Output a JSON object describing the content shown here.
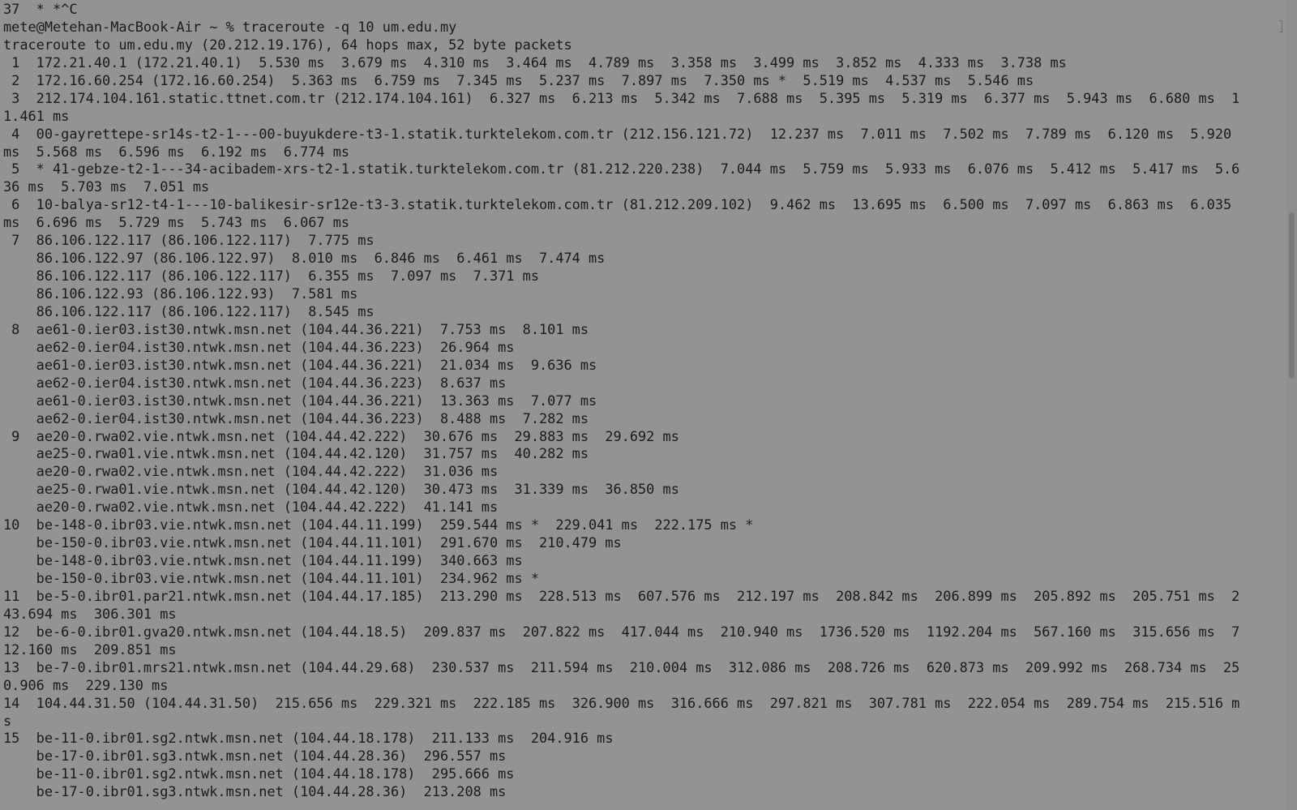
{
  "terminal": {
    "lines": [
      "37  * *^C",
      "mete@Metehan-MacBook-Air ~ % traceroute -q 10 um.edu.my",
      "traceroute to um.edu.my (20.212.19.176), 64 hops max, 52 byte packets",
      " 1  172.21.40.1 (172.21.40.1)  5.530 ms  3.679 ms  4.310 ms  3.464 ms  4.789 ms  3.358 ms  3.499 ms  3.852 ms  4.333 ms  3.738 ms",
      " 2  172.16.60.254 (172.16.60.254)  5.363 ms  6.759 ms  7.345 ms  5.237 ms  7.897 ms  7.350 ms *  5.519 ms  4.537 ms  5.546 ms",
      " 3  212.174.104.161.static.ttnet.com.tr (212.174.104.161)  6.327 ms  6.213 ms  5.342 ms  7.688 ms  5.395 ms  5.319 ms  6.377 ms  5.943 ms  6.680 ms  1",
      "1.461 ms",
      " 4  00-gayrettepe-sr14s-t2-1---00-buyukdere-t3-1.statik.turktelekom.com.tr (212.156.121.72)  12.237 ms  7.011 ms  7.502 ms  7.789 ms  6.120 ms  5.920",
      "ms  5.568 ms  6.596 ms  6.192 ms  6.774 ms",
      " 5  * 41-gebze-t2-1---34-acibadem-xrs-t2-1.statik.turktelekom.com.tr (81.212.220.238)  7.044 ms  5.759 ms  5.933 ms  6.076 ms  5.412 ms  5.417 ms  5.6",
      "36 ms  5.703 ms  7.051 ms",
      " 6  10-balya-sr12-t4-1---10-balikesir-sr12e-t3-3.statik.turktelekom.com.tr (81.212.209.102)  9.462 ms  13.695 ms  6.500 ms  7.097 ms  6.863 ms  6.035",
      "ms  6.696 ms  5.729 ms  5.743 ms  6.067 ms",
      " 7  86.106.122.117 (86.106.122.117)  7.775 ms",
      "    86.106.122.97 (86.106.122.97)  8.010 ms  6.846 ms  6.461 ms  7.474 ms",
      "    86.106.122.117 (86.106.122.117)  6.355 ms  7.097 ms  7.371 ms",
      "    86.106.122.93 (86.106.122.93)  7.581 ms",
      "    86.106.122.117 (86.106.122.117)  8.545 ms",
      " 8  ae61-0.ier03.ist30.ntwk.msn.net (104.44.36.221)  7.753 ms  8.101 ms",
      "    ae62-0.ier04.ist30.ntwk.msn.net (104.44.36.223)  26.964 ms",
      "    ae61-0.ier03.ist30.ntwk.msn.net (104.44.36.221)  21.034 ms  9.636 ms",
      "    ae62-0.ier04.ist30.ntwk.msn.net (104.44.36.223)  8.637 ms",
      "    ae61-0.ier03.ist30.ntwk.msn.net (104.44.36.221)  13.363 ms  7.077 ms",
      "    ae62-0.ier04.ist30.ntwk.msn.net (104.44.36.223)  8.488 ms  7.282 ms",
      " 9  ae20-0.rwa02.vie.ntwk.msn.net (104.44.42.222)  30.676 ms  29.883 ms  29.692 ms",
      "    ae25-0.rwa01.vie.ntwk.msn.net (104.44.42.120)  31.757 ms  40.282 ms",
      "    ae20-0.rwa02.vie.ntwk.msn.net (104.44.42.222)  31.036 ms",
      "    ae25-0.rwa01.vie.ntwk.msn.net (104.44.42.120)  30.473 ms  31.339 ms  36.850 ms",
      "    ae20-0.rwa02.vie.ntwk.msn.net (104.44.42.222)  41.141 ms",
      "10  be-148-0.ibr03.vie.ntwk.msn.net (104.44.11.199)  259.544 ms *  229.041 ms  222.175 ms *",
      "    be-150-0.ibr03.vie.ntwk.msn.net (104.44.11.101)  291.670 ms  210.479 ms",
      "    be-148-0.ibr03.vie.ntwk.msn.net (104.44.11.199)  340.663 ms",
      "    be-150-0.ibr03.vie.ntwk.msn.net (104.44.11.101)  234.962 ms *",
      "11  be-5-0.ibr01.par21.ntwk.msn.net (104.44.17.185)  213.290 ms  228.513 ms  607.576 ms  212.197 ms  208.842 ms  206.899 ms  205.892 ms  205.751 ms  2",
      "43.694 ms  306.301 ms",
      "12  be-6-0.ibr01.gva20.ntwk.msn.net (104.44.18.5)  209.837 ms  207.822 ms  417.044 ms  210.940 ms  1736.520 ms  1192.204 ms  567.160 ms  315.656 ms  7",
      "12.160 ms  209.851 ms",
      "13  be-7-0.ibr01.mrs21.ntwk.msn.net (104.44.29.68)  230.537 ms  211.594 ms  210.004 ms  312.086 ms  208.726 ms  620.873 ms  209.992 ms  268.734 ms  25",
      "0.906 ms  229.130 ms",
      "14  104.44.31.50 (104.44.31.50)  215.656 ms  229.321 ms  222.185 ms  326.900 ms  316.666 ms  297.821 ms  307.781 ms  222.054 ms  289.754 ms  215.516 m",
      "s",
      "15  be-11-0.ibr01.sg2.ntwk.msn.net (104.44.18.178)  211.133 ms  204.916 ms",
      "    be-17-0.ibr01.sg3.ntwk.msn.net (104.44.28.36)  296.557 ms",
      "    be-11-0.ibr01.sg2.ntwk.msn.net (104.44.18.178)  295.666 ms",
      "    be-17-0.ibr01.sg3.ntwk.msn.net (104.44.28.36)  213.208 ms"
    ]
  }
}
